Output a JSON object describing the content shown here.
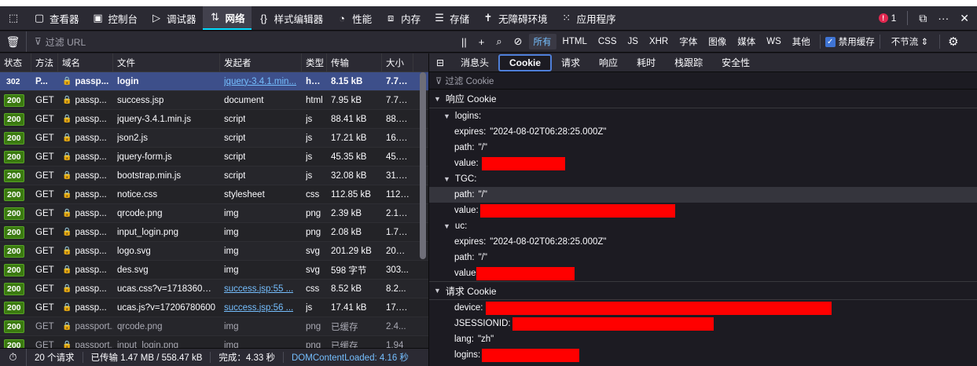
{
  "toolbar": {
    "tabs": [
      {
        "label": "查看器",
        "icon": "inspector-icon"
      },
      {
        "label": "控制台",
        "icon": "console-icon"
      },
      {
        "label": "调试器",
        "icon": "debugger-icon"
      },
      {
        "label": "网络",
        "icon": "network-icon"
      },
      {
        "label": "样式编辑器",
        "icon": "style-editor-icon"
      },
      {
        "label": "性能",
        "icon": "performance-icon"
      },
      {
        "label": "内存",
        "icon": "memory-icon"
      },
      {
        "label": "存储",
        "icon": "storage-icon"
      },
      {
        "label": "无障碍环境",
        "icon": "accessibility-icon"
      },
      {
        "label": "应用程序",
        "icon": "application-icon"
      }
    ],
    "active_tab": "网络",
    "error_count": "1"
  },
  "filterbar": {
    "url_placeholder": "过滤 URL",
    "types": [
      "所有",
      "HTML",
      "CSS",
      "JS",
      "XHR",
      "字体",
      "图像",
      "媒体",
      "WS",
      "其他"
    ],
    "active_type": "所有",
    "disable_cache_label": "禁用缓存",
    "throttle_label": "不节流 ⇕"
  },
  "table": {
    "headers": [
      "状态",
      "方法",
      "域名",
      "文件",
      "发起者",
      "类型",
      "传输",
      "大小"
    ],
    "rows": [
      {
        "status": "302",
        "method": "P...",
        "domain": "passp...",
        "file": "login",
        "initiator": "jquery-3.4.1.min...",
        "type": "html",
        "transferred": "8.15 kB",
        "size": "7.77...",
        "selected": true,
        "link": true
      },
      {
        "status": "200",
        "method": "GET",
        "domain": "passp...",
        "file": "success.jsp",
        "initiator": "document",
        "type": "html",
        "transferred": "7.95 kB",
        "size": "7.77..."
      },
      {
        "status": "200",
        "method": "GET",
        "domain": "passp...",
        "file": "jquery-3.4.1.min.js",
        "initiator": "script",
        "type": "js",
        "transferred": "88.41 kB",
        "size": "88.1..."
      },
      {
        "status": "200",
        "method": "GET",
        "domain": "passp...",
        "file": "json2.js",
        "initiator": "script",
        "type": "js",
        "transferred": "17.21 kB",
        "size": "16.9..."
      },
      {
        "status": "200",
        "method": "GET",
        "domain": "passp...",
        "file": "jquery-form.js",
        "initiator": "script",
        "type": "js",
        "transferred": "45.35 kB",
        "size": "45.3..."
      },
      {
        "status": "200",
        "method": "GET",
        "domain": "passp...",
        "file": "bootstrap.min.js",
        "initiator": "script",
        "type": "js",
        "transferred": "32.08 kB",
        "size": "31.8..."
      },
      {
        "status": "200",
        "method": "GET",
        "domain": "passp...",
        "file": "notice.css",
        "initiator": "stylesheet",
        "type": "css",
        "transferred": "112.85 kB",
        "size": "112...."
      },
      {
        "status": "200",
        "method": "GET",
        "domain": "passp...",
        "file": "qrcode.png",
        "initiator": "img",
        "type": "png",
        "transferred": "2.39 kB",
        "size": "2.10..."
      },
      {
        "status": "200",
        "method": "GET",
        "domain": "passp...",
        "file": "input_login.png",
        "initiator": "img",
        "type": "png",
        "transferred": "2.08 kB",
        "size": "1.79..."
      },
      {
        "status": "200",
        "method": "GET",
        "domain": "passp...",
        "file": "logo.svg",
        "initiator": "img",
        "type": "svg",
        "transferred": "201.29 kB",
        "size": "200...."
      },
      {
        "status": "200",
        "method": "GET",
        "domain": "passp...",
        "file": "des.svg",
        "initiator": "img",
        "type": "svg",
        "transferred": "598 字节",
        "size": "303..."
      },
      {
        "status": "200",
        "method": "GET",
        "domain": "passp...",
        "file": "ucas.css?v=17183604100",
        "initiator": "success.jsp:55 ...",
        "type": "css",
        "transferred": "8.52 kB",
        "size": "8.2...",
        "link": true
      },
      {
        "status": "200",
        "method": "GET",
        "domain": "passp...",
        "file": "ucas.js?v=17206780600",
        "initiator": "success.jsp:56 ...",
        "type": "js",
        "transferred": "17.41 kB",
        "size": "17.1...",
        "link": true
      },
      {
        "status": "200",
        "method": "GET",
        "domain": "passport...",
        "file": "qrcode.png",
        "initiator": "img",
        "type": "png",
        "transferred": "已缓存",
        "size": "2.4...",
        "dim": true
      },
      {
        "status": "200",
        "method": "GET",
        "domain": "passport...",
        "file": "input_login.png",
        "initiator": "img",
        "type": "png",
        "transferred": "已缓存",
        "size": "1.94",
        "dim": true
      }
    ]
  },
  "statusbar": {
    "requests": "20 个请求",
    "transferred": "已传输 1.47 MB / 558.47 kB",
    "finish": "完成：4.33 秒",
    "dcl": "DOMContentLoaded: 4.16 秒"
  },
  "panel": {
    "tabs": [
      "消息头",
      "Cookie",
      "请求",
      "响应",
      "耗时",
      "栈跟踪",
      "安全性"
    ],
    "active_tab": "Cookie",
    "filter_placeholder": "过滤 Cookie",
    "response_section": "响应 Cookie",
    "request_section": "请求 Cookie",
    "logins_label": "logins:",
    "expires_label": "expires:",
    "expires_value": "\"2024-08-02T06:28:25.000Z\"",
    "path_label": "path:",
    "path_value": "\"/\"",
    "value_label": "value:",
    "value_label_nocolon": "value",
    "tgc_label": "TGC:",
    "uc_label": "uc:",
    "device_label": "device:",
    "jsessionid_label": "JSESSIONID:",
    "lang_label": "lang:",
    "lang_value": "\"zh\"",
    "req_logins_label": "logins:"
  },
  "colors": {
    "accent": "#00ddff",
    "redaction": "#ff0000",
    "ok_badge": "#3b7a10",
    "selected_row": "#3d4f8a"
  }
}
